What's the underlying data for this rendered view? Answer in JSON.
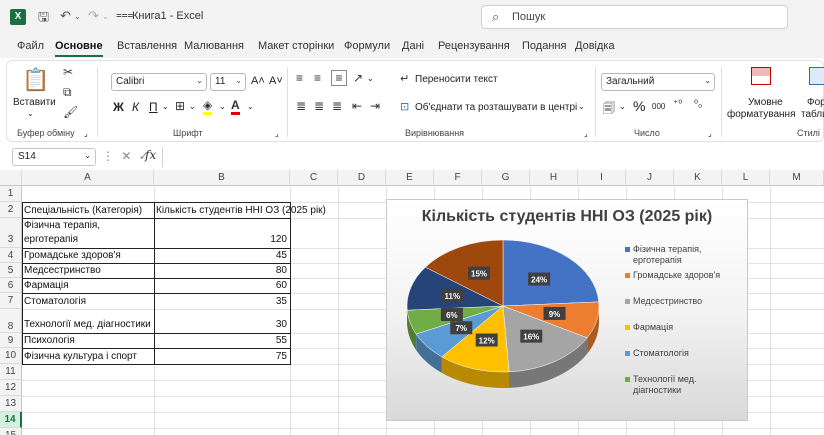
{
  "window": {
    "title": "Книга1 - Excel",
    "search_placeholder": "Пошук",
    "app_icon": "excel-logo-icon"
  },
  "menu": {
    "tabs": [
      "Файл",
      "Основне",
      "Вставлення",
      "Малювання",
      "Макет сторінки",
      "Формули",
      "Дані",
      "Рецензування",
      "Подання",
      "Довідка"
    ],
    "active": "Основне"
  },
  "ribbon": {
    "clipboard": {
      "paste": "Вставити",
      "label": "Буфер обміну"
    },
    "font": {
      "name": "Calibri",
      "size": "11",
      "label": "Шрифт",
      "bold": "Ж",
      "italic": "К",
      "underline": "П",
      "inc": "A˄",
      "dec": "A˅"
    },
    "alignment": {
      "wrap": "Переносити текст",
      "merge": "Об'єднати та розташувати в центрі",
      "label": "Вирівнювання"
    },
    "number": {
      "format": "Загальний",
      "percent": "%",
      "thousands": "000",
      "label": "Число"
    },
    "styles": {
      "conditional": "Умовне",
      "conditional2": "форматування",
      "table": "Форм",
      "table2": "табли",
      "label": "Стилі"
    }
  },
  "formula_bar": {
    "name_box": "S14",
    "fx": "fx",
    "value": ""
  },
  "columns": [
    "A",
    "B",
    "C",
    "D",
    "E",
    "F",
    "G",
    "H",
    "I",
    "J",
    "K",
    "L",
    "M"
  ],
  "rows": [
    "1",
    "2",
    "3",
    "4",
    "5",
    "6",
    "7",
    "8",
    "9",
    "10",
    "11",
    "12",
    "13",
    "14",
    "15"
  ],
  "selected_row": "14",
  "table": {
    "header_a": "Спеціальність (Категорія)",
    "header_b": "Кількість студентів ННІ ОЗ (2025 рік)",
    "rows": [
      {
        "name_line1": "Фізична терапія,",
        "name_line2": "ерготерапія",
        "value": "120"
      },
      {
        "name": "Громадське здоров'я",
        "value": "45"
      },
      {
        "name": "Медсестринство",
        "value": "80"
      },
      {
        "name": "Фармація",
        "value": "60"
      },
      {
        "name": "Стоматологія",
        "value": "35"
      },
      {
        "name": "Технології мед. діагностики",
        "value": "30"
      },
      {
        "name": "Психологія",
        "value": "55"
      },
      {
        "name": "Фізична культура і спорт",
        "value": "75"
      }
    ]
  },
  "chart_data": {
    "type": "pie",
    "title": "Кількість студентів ННІ ОЗ (2025 рік)",
    "categories": [
      "Фізична терапія, ерготерапія",
      "Громадське здоров'я",
      "Медсестринство",
      "Фармація",
      "Стоматологія",
      "Технології мед. діагностики",
      "Психологія",
      "Фізична культура і спорт"
    ],
    "values": [
      120,
      45,
      80,
      60,
      35,
      30,
      55,
      75
    ],
    "data_labels": [
      "24%",
      "9%",
      "16%",
      "12%",
      "7%",
      "6%",
      "11%",
      "15%"
    ],
    "colors": [
      "#4472c4",
      "#ed7d31",
      "#a5a5a5",
      "#ffc000",
      "#5b9bd5",
      "#70ad47",
      "#264478",
      "#9e480e"
    ],
    "legend_visible": [
      "Фізична терапія, ерготерапія",
      "Громадське здоров'я",
      "Медсестринство",
      "Фармація",
      "Стоматологія",
      "Технології мед. діагностики"
    ],
    "legend_position": "right",
    "style": "3d"
  }
}
